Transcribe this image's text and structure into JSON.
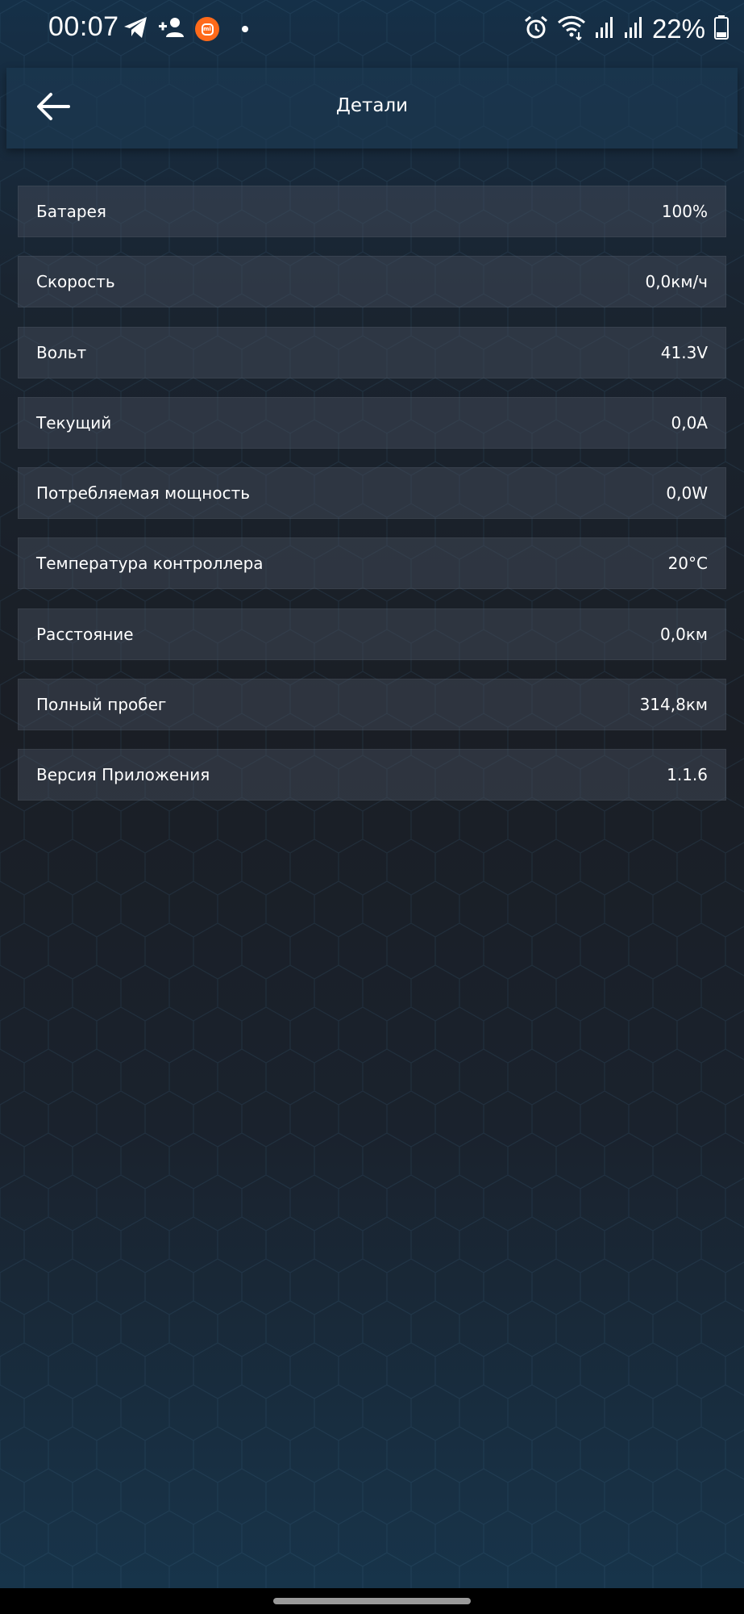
{
  "status_bar": {
    "time": "00:07",
    "battery_percent": "22%",
    "icons": [
      "telegram-icon",
      "person-add-icon",
      "mi-app-icon",
      "notification-dot-icon",
      "alarm-icon",
      "wifi-icon",
      "signal-icon",
      "signal-icon",
      "battery-icon"
    ]
  },
  "header": {
    "title": "Детали",
    "back_icon": "arrow-left-icon"
  },
  "details": {
    "rows": [
      {
        "label": "Батарея",
        "value": "100%"
      },
      {
        "label": "Скорость",
        "value": "0,0км/ч"
      },
      {
        "label": "Вольт",
        "value": "41.3V"
      },
      {
        "label": "Текущий",
        "value": "0,0A"
      },
      {
        "label": "Потребляемая мощность",
        "value": "0,0W"
      },
      {
        "label": "Температура контроллера",
        "value": "20°C"
      },
      {
        "label": "Расстояние",
        "value": "0,0км"
      },
      {
        "label": "Полный пробег",
        "value": "314,8км"
      },
      {
        "label": "Версия Приложения",
        "value": "1.1.6"
      }
    ]
  },
  "colors": {
    "background_top": "#153048",
    "background_mid": "#1a1e25",
    "background_bottom": "#17354c",
    "row_background": "#3b424f",
    "mi_badge": "#ff6a1a",
    "text": "#ffffff"
  }
}
